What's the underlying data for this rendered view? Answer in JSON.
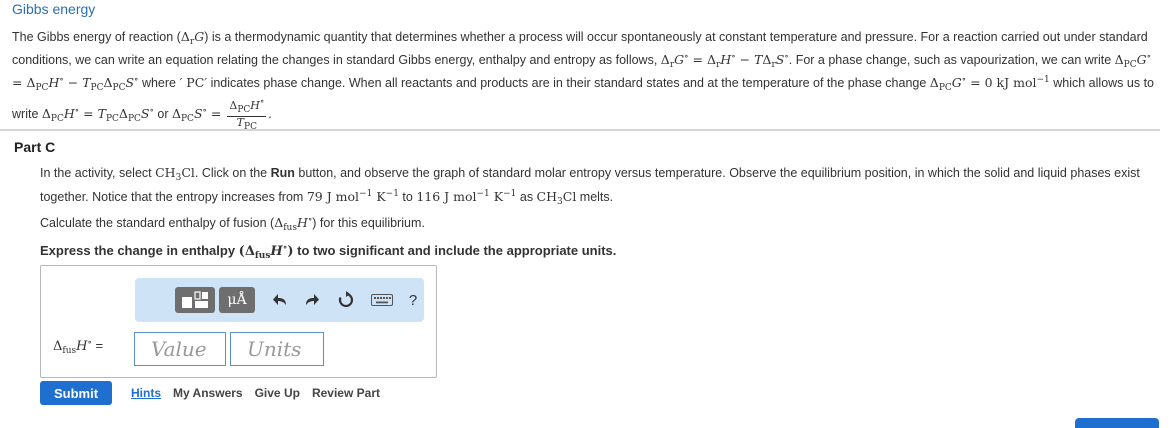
{
  "page": {
    "title": "Gibbs energy"
  },
  "intro": {
    "s1": "The Gibbs energy of reaction (",
    "s2": ") is a thermodynamic quantity that determines whether a process will occur spontaneously at constant temperature and pressure. For a reaction carried out under standard conditions, we can write an equation relating the changes in standard Gibbs energy, enthalpy and entropy as follows, ",
    "s3": ". For a phase change, such as vapourization, we can write ",
    "s4": " where ",
    "s5": " indicates phase change. When all reactants and products are in their standard states and at the temperature of the phase change ",
    "s6": " which allows us to write ",
    "s7": " or ",
    "s8": "."
  },
  "part": {
    "title": "Part C"
  },
  "activity": {
    "t1": "In the activity, select ",
    "t2": ". Click on the ",
    "run": "Run",
    "t3": " button, and observe the graph of standard molar entropy versus temperature. Observe the equilibrium position, in which the solid and liquid phases exist together. Notice that the entropy increases from ",
    "t4": " to ",
    "t5": " as ",
    "t6": " melts."
  },
  "question": {
    "t1": "Calculate the standard enthalpy of fusion (",
    "t2": ") for this equilibrium."
  },
  "instruction": {
    "t1": "Express the change in enthalpy ",
    "t2": " to two significant and include the appropriate units."
  },
  "answer": {
    "units_symbol": "μÅ",
    "help": "?",
    "equals": "=",
    "value_placeholder": "Value",
    "units_placeholder": "Units"
  },
  "actions": {
    "submit": "Submit",
    "hints": "Hints",
    "my_answers": "My Answers",
    "give_up": "Give Up",
    "review_part": "Review Part"
  }
}
